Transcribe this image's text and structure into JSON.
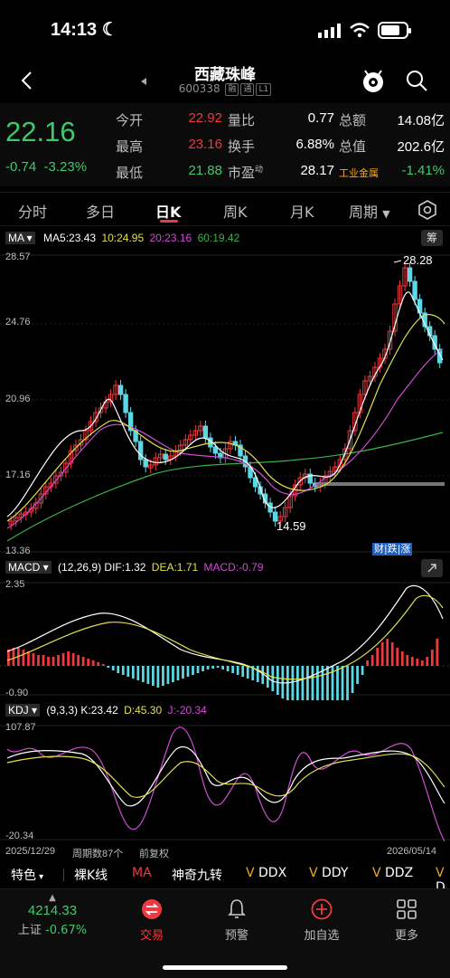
{
  "status": {
    "time": "14:13"
  },
  "header": {
    "title": "西藏珠峰",
    "code": "600338",
    "tags": [
      "融",
      "通",
      "L1"
    ]
  },
  "quote": {
    "price": "22.16",
    "change": "-0.74",
    "change_pct": "-3.23%",
    "rows": [
      {
        "l1": "今开",
        "v1": "22.92",
        "l2": "量比",
        "v2": "0.77",
        "l3": "总额",
        "v3": "14.08亿"
      },
      {
        "l1": "最高",
        "v1": "23.16",
        "l2": "换手",
        "v2": "6.88%",
        "l3": "总值",
        "v3": "202.6亿"
      },
      {
        "l1": "最低",
        "v1": "21.88",
        "l2": "市盈",
        "l2sup": "动",
        "v2": "28.17",
        "l3": "工业金属",
        "v3": "-1.41%"
      }
    ]
  },
  "tabs": [
    "分时",
    "多日",
    "日K",
    "周K",
    "月K",
    "周期"
  ],
  "ma": {
    "label": "MA",
    "ma5": "MA5:23.43",
    "ma10": "10:24.95",
    "ma20": "20:23.16",
    "ma60": "60:19.42",
    "badge": "筹"
  },
  "main_axis": {
    "top": "28.57",
    "l2": "24.76",
    "l3": "20.96",
    "l4": "17.16",
    "bottom": "13.36",
    "high_mark": "28.28",
    "low_mark": "14.59",
    "badge": "财|跌|涨"
  },
  "macd": {
    "label": "MACD",
    "params": "(12,26,9)",
    "dif": "DIF:1.32",
    "dea": "DEA:1.71",
    "macd": "MACD:-0.79",
    "top": "2.35",
    "bottom": "-0.90"
  },
  "kdj": {
    "label": "KDJ",
    "params": "(9,3,3)",
    "k": "K:23.42",
    "d": "D:45.30",
    "j": "J:-20.34",
    "top": "107.87",
    "bottom": "-20.34",
    "start_date": "2025/12/29",
    "period_count": "周期数87个",
    "adjust": "前复权",
    "end_date": "2026/05/14"
  },
  "toolbar": [
    "特色",
    "裸K线",
    "MA",
    "神奇九转",
    "DDX",
    "DDY",
    "DDZ",
    "D"
  ],
  "bottom_nav": {
    "index_value": "4214.33",
    "index_name": "上证",
    "index_change": "-0.67%",
    "items": [
      "交易",
      "预警",
      "加自选",
      "更多"
    ]
  },
  "colors": {
    "up": "#f0393e",
    "down": "#5ad8e6",
    "ma5": "#ffffff",
    "ma10": "#e3e04a",
    "ma20": "#d14bd6",
    "ma60": "#3bb34a"
  }
}
